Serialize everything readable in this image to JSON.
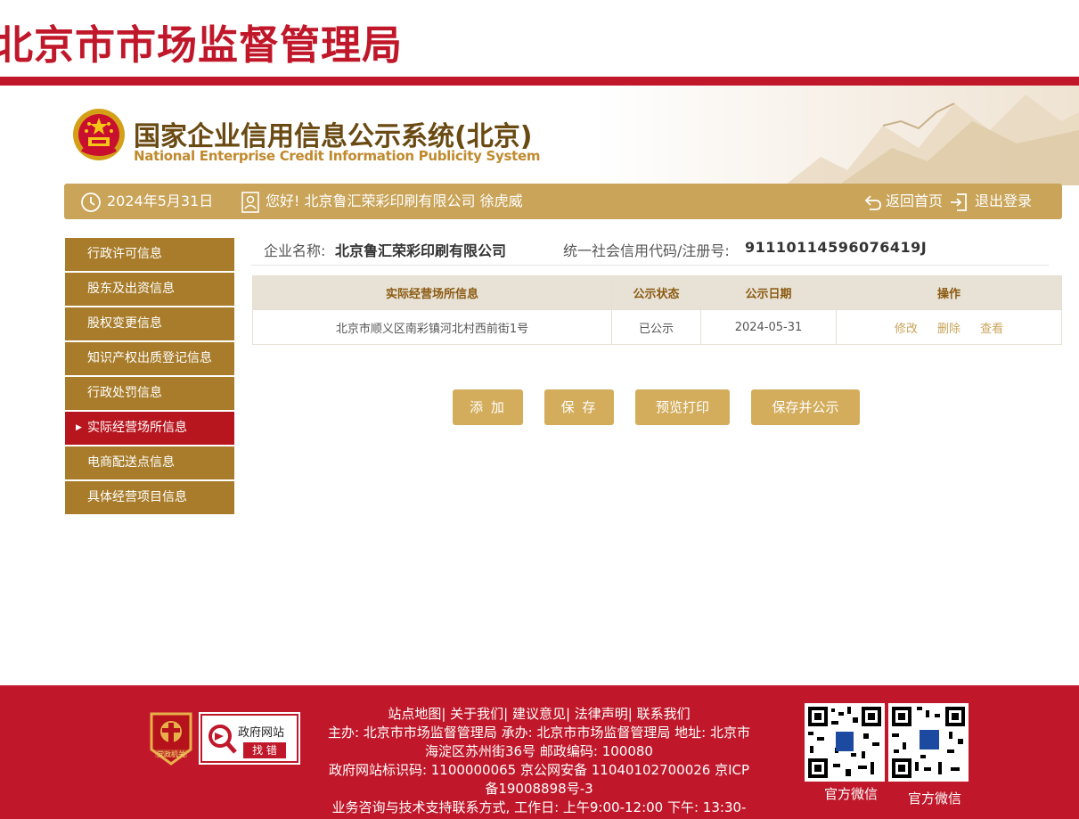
{
  "top_title": "北京市市场监督管理局",
  "system": {
    "title_cn": "国家企业信用信息公示系统(北京)",
    "title_en": "National Enterprise Credit Information Publicity System"
  },
  "infobar": {
    "date": "2024年5月31日",
    "greeting": "您好!  北京鲁汇荣彩印刷有限公司   徐虎威",
    "home_label": "返回首页",
    "logout_label": "退出登录"
  },
  "sidebar": {
    "items": [
      {
        "label": "行政许可信息",
        "active": false
      },
      {
        "label": "股东及出资信息",
        "active": false
      },
      {
        "label": "股权变更信息",
        "active": false
      },
      {
        "label": "知识产权出质登记信息",
        "active": false
      },
      {
        "label": "行政处罚信息",
        "active": false
      },
      {
        "label": "实际经营场所信息",
        "active": true
      },
      {
        "label": "电商配送点信息",
        "active": false
      },
      {
        "label": "具体经营项目信息",
        "active": false
      }
    ]
  },
  "company": {
    "name_label": "企业名称:",
    "name_value": "北京鲁汇荣彩印刷有限公司",
    "code_label": "统一社会信用代码/注册号:",
    "code_value": "91110114596076419J"
  },
  "table": {
    "headers": [
      "实际经营场所信息",
      "公示状态",
      "公示日期",
      "操作"
    ],
    "rows": [
      {
        "address": "北京市顺义区南彩镇河北村西前街1号",
        "status": "已公示",
        "date": "2024-05-31",
        "ops": [
          "修改",
          "删除",
          "查看"
        ]
      }
    ]
  },
  "buttons": {
    "add": "添 加",
    "save": "保 存",
    "preview": "预览打印",
    "save_publish": "保存并公示"
  },
  "footer": {
    "links": "站点地图| 关于我们| 建议意见| 法律声明| 联系我们",
    "line1": "主办: 北京市市场监督管理局 承办: 北京市市场监督管理局 地址: 北京市",
    "line2": "海淀区苏州街36号 邮政编码: 100080",
    "line3": "政府网站标识码: 1100000065     京公网安备 11040102700026     京ICP",
    "line4": "备19008898号-3",
    "line5": "业务咨询与技术支持联系方式,  工作日: 上午9:00-12:00 下午: 13:30-",
    "badge_text1": "政府网站",
    "badge_text2": "找 错",
    "badge_party": "党政机关",
    "qr1_label": "官方微信",
    "qr2_label": "官方微信"
  },
  "colors": {
    "brand_red": "#c0182a",
    "gold": "#c9a459",
    "menu_brown": "#a87c2a",
    "active_red": "#b8161f"
  }
}
